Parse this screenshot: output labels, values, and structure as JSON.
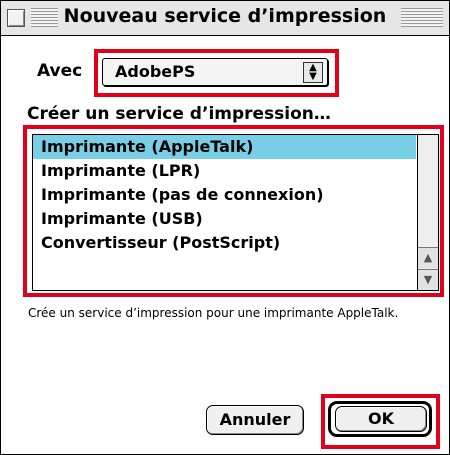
{
  "window": {
    "title": "Nouveau service d’impression"
  },
  "form": {
    "with_label": "Avec",
    "driver_value": "AdobePS",
    "create_label": "Créer un service d’impression…"
  },
  "list": {
    "items": [
      "Imprimante (AppleTalk)",
      "Imprimante (LPR)",
      "Imprimante (pas de connexion)",
      "Imprimante (USB)",
      "Convertisseur (PostScript)"
    ],
    "selected_index": 0
  },
  "description": "Crée un service d’impression pour une imprimante AppleTalk.",
  "buttons": {
    "cancel": "Annuler",
    "ok": "OK"
  },
  "colors": {
    "selection": "#78cfe6",
    "highlight_box": "#e3001b"
  }
}
